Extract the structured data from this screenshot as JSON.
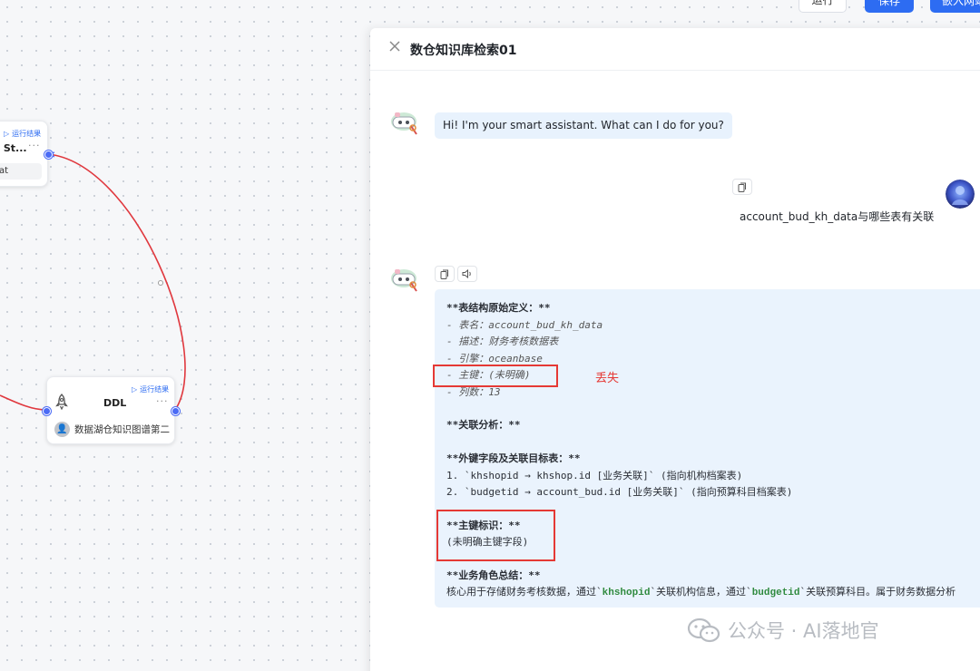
{
  "toolbar": {
    "run_label": "运行",
    "save_label": "保存",
    "embed_label": "嵌入网站"
  },
  "canvas": {
    "node_a": {
      "run_result_label": "运行结果",
      "title": "L St...",
      "field": "at"
    },
    "node_b": {
      "run_result_label": "运行结果",
      "title": "DDL",
      "field": "数据湖仓知识图谱第二"
    }
  },
  "panel": {
    "title": "数仓知识库检索01",
    "greeting": "Hi! I'm your smart assistant. What can I do for you?",
    "user_message": "account_bud_kh_data与哪些表有关联",
    "answer": {
      "lines": [
        "**表结构原始定义：**",
        "- 表名：account_bud_kh_data",
        "- 描述：财务考核数据表",
        "- 引擎：oceanbase",
        "- 主键：(未明确)",
        "- 列数：13",
        "**关联分析：**",
        "**外键字段及关联目标表：**",
        "1. `khshopid → khshop.id [业务关联]` (指向机构档案表)",
        "2. `budgetid → account_bud.id [业务关联]` (指向预算科目档案表)",
        "**主键标识：**",
        "(未明确主键字段)",
        "**业务角色总结：**"
      ],
      "summary_prefix": "核心用于存储财务考核数据，通过`",
      "summary_code_1": "khshopid",
      "summary_middle": "`关联机构信息，通过`",
      "summary_code_2": "budgetid",
      "summary_suffix": "`关联预算科目。属于财务数据分析"
    }
  },
  "annotation": "丢失",
  "watermark": "公众号 · AI落地官",
  "colors": {
    "primary": "#2d6cf2",
    "annotation_red": "#e53935",
    "answer_bg": "#eaf3fd",
    "edge_red": "#e0383e"
  }
}
